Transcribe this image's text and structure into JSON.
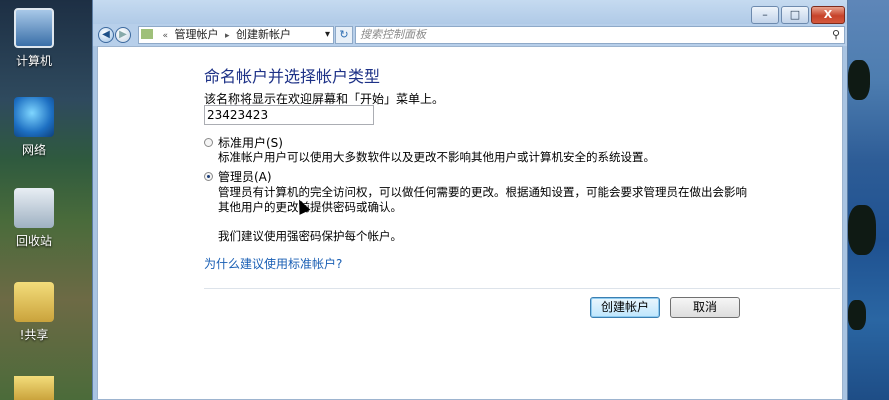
{
  "desktop": {
    "icons": [
      {
        "name": "computer",
        "label": "计算机"
      },
      {
        "name": "network",
        "label": "网络"
      },
      {
        "name": "recycle-bin",
        "label": "回收站"
      },
      {
        "name": "share",
        "label": "!共享"
      }
    ]
  },
  "window": {
    "controls": {
      "minimize": "–",
      "maximize": "□",
      "close": "X"
    }
  },
  "navigation": {
    "back_icon": "back-arrow-icon",
    "forward_icon": "forward-arrow-icon",
    "address": {
      "prefix": "«",
      "segments": [
        "管理帐户",
        "创建新帐户"
      ],
      "separator": "▸",
      "dropdown": "▾"
    },
    "refresh": "↻",
    "search_placeholder": "搜索控制面板"
  },
  "form": {
    "heading": "命名帐户并选择帐户类型",
    "name_label": "该名称将显示在欢迎屏幕和「开始」菜单上。",
    "name_value": "23423423",
    "standard": {
      "label": "标准用户(S)",
      "description": "标准帐户用户可以使用大多数软件以及更改不影响其他用户或计算机安全的系统设置。",
      "checked": false
    },
    "admin": {
      "label": "管理员(A)",
      "description_line1": "管理员有计算机的完全访问权，可以做任何需要的更改。根据通知设置，可能会要求管理员在做出会影响",
      "description_line2": "其他用户的更改前提供密码或确认。",
      "recommendation": "我们建议使用强密码保护每个帐户。",
      "checked": true
    },
    "help_link": "为什么建议使用标准帐户?",
    "create_button": "创建帐户",
    "cancel_button": "取消"
  },
  "colors": {
    "heading": "#1e3287",
    "link": "#1a5fb4",
    "window_frame": "#a9c4e2"
  }
}
